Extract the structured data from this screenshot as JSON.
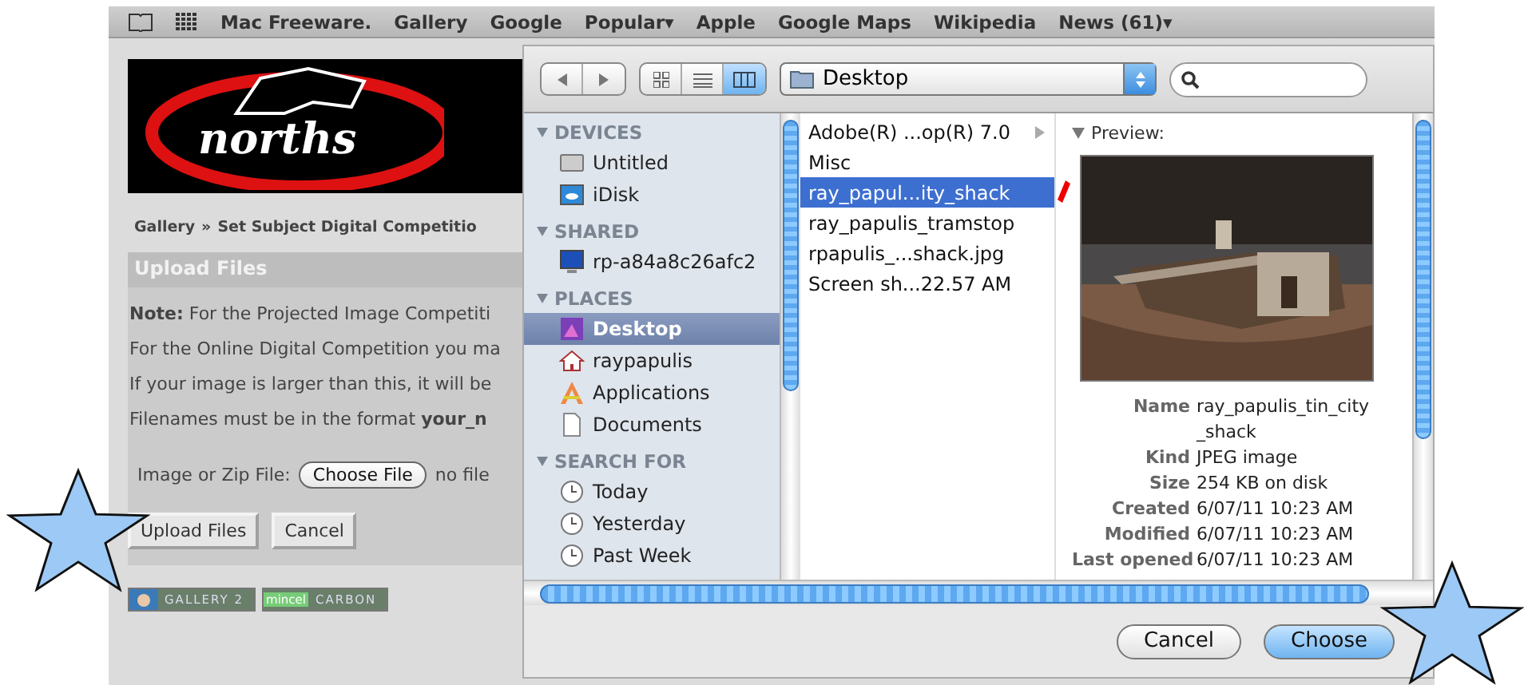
{
  "bookmarks_bar": {
    "items": [
      {
        "label": "Mac Freeware."
      },
      {
        "label": "Gallery"
      },
      {
        "label": "Google"
      },
      {
        "label": "Popular▾"
      },
      {
        "label": "Apple"
      },
      {
        "label": "Google Maps"
      },
      {
        "label": "Wikipedia"
      },
      {
        "label": "News (61)▾"
      }
    ]
  },
  "web_page": {
    "logo": "norths",
    "breadcrumb": [
      "Gallery",
      "»",
      "Set Subject Digital Competitio"
    ],
    "panel_title": "Upload Files",
    "notes": [
      "**Note:** For the Projected Image Competiti",
      "For the Online Digital Competition you ma",
      "If your image is larger than this, it will be",
      "Filenames must be in the format **your_n**"
    ],
    "file_field": {
      "label": "Image or Zip File:",
      "button": "Choose File",
      "status": "no file"
    },
    "buttons": [
      "Upload Files",
      "Cancel"
    ],
    "badges": [
      {
        "kind": "gallery",
        "text": "GALLERY 2"
      },
      {
        "kind": "mincel",
        "mark": "mincel",
        "text": "CARBON"
      }
    ]
  },
  "dialog": {
    "location": "Desktop",
    "sidebar": [
      {
        "title": "DEVICES",
        "items": [
          {
            "label": "Untitled",
            "kind": "disk",
            "selected": false
          },
          {
            "label": "iDisk",
            "kind": "idisk",
            "selected": false
          }
        ]
      },
      {
        "title": "SHARED",
        "items": [
          {
            "label": "rp-a84a8c26afc2",
            "kind": "computer",
            "selected": false
          }
        ]
      },
      {
        "title": "PLACES",
        "items": [
          {
            "label": "Desktop",
            "kind": "desktop",
            "selected": true
          },
          {
            "label": "raypapulis",
            "kind": "home",
            "selected": false
          },
          {
            "label": "Applications",
            "kind": "applications",
            "selected": false
          },
          {
            "label": "Documents",
            "kind": "documents",
            "selected": false
          }
        ]
      },
      {
        "title": "SEARCH FOR",
        "items": [
          {
            "label": "Today",
            "kind": "clock",
            "selected": false
          },
          {
            "label": "Yesterday",
            "kind": "clock",
            "selected": false
          },
          {
            "label": "Past Week",
            "kind": "clock",
            "selected": false
          }
        ]
      }
    ],
    "files": [
      {
        "name": "Adobe(R) ...op(R) 7.0",
        "folder": true,
        "selected": false
      },
      {
        "name": "Misc",
        "folder": false,
        "selected": false
      },
      {
        "name": "ray_papul...ity_shack",
        "folder": false,
        "selected": true
      },
      {
        "name": "ray_papulis_tramstop",
        "folder": false,
        "selected": false
      },
      {
        "name": "rpapulis_...shack.jpg",
        "folder": false,
        "selected": false
      },
      {
        "name": "Screen sh...22.57 AM",
        "folder": false,
        "selected": false
      }
    ],
    "preview": {
      "title": "Preview:",
      "info": [
        {
          "label": "Name",
          "value": "ray_papulis_tin_city _shack"
        },
        {
          "label": "Kind",
          "value": "JPEG image"
        },
        {
          "label": "Size",
          "value": "254 KB on disk"
        },
        {
          "label": "Created",
          "value": "6/07/11 10:23 AM"
        },
        {
          "label": "Modified",
          "value": "6/07/11 10:23 AM"
        },
        {
          "label": "Last opened",
          "value": "6/07/11 10:23 AM"
        }
      ]
    },
    "buttons": [
      {
        "label": "Cancel",
        "default": false
      },
      {
        "label": "Choose",
        "default": true
      }
    ]
  },
  "annotations": [
    {
      "kind": "star"
    },
    {
      "kind": "star"
    },
    {
      "kind": "pen_mark"
    }
  ]
}
